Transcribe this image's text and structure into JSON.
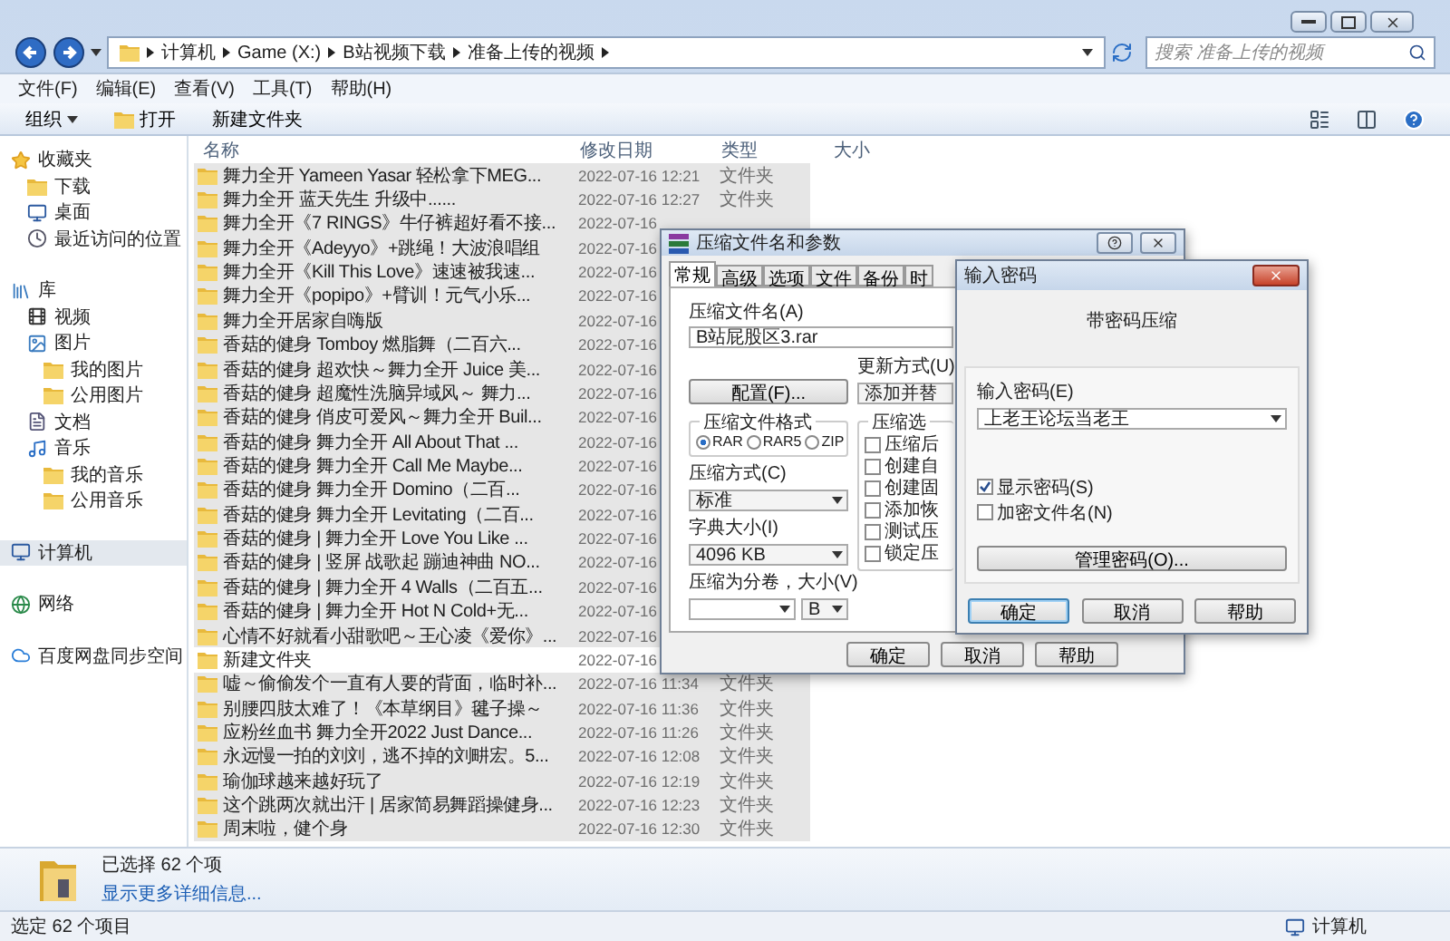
{
  "address_bar": {
    "crumbs": [
      "计算机",
      "Game (X:)",
      "B站视频下载",
      "准备上传的视频"
    ]
  },
  "search": {
    "placeholder": "搜索 准备上传的视频"
  },
  "menu": [
    "文件(F)",
    "编辑(E)",
    "查看(V)",
    "工具(T)",
    "帮助(H)"
  ],
  "toolbar": [
    {
      "kind": "menu",
      "label": "组织"
    },
    {
      "kind": "open",
      "label": "打开"
    },
    {
      "kind": "plain",
      "label": "新建文件夹"
    }
  ],
  "sidebar": [
    {
      "label": "收藏夹",
      "kind": "star",
      "selected": false,
      "children": [
        {
          "label": "下载",
          "kind": "folder",
          "selected": false
        },
        {
          "label": "桌面",
          "kind": "desktop",
          "selected": false
        },
        {
          "label": "最近访问的位置",
          "kind": "recent",
          "selected": false
        }
      ]
    },
    {
      "label": "库",
      "kind": "library",
      "selected": false,
      "children": [
        {
          "label": "视频",
          "kind": "video",
          "selected": false
        },
        {
          "label": "图片",
          "kind": "pictures",
          "selected": false,
          "children": [
            {
              "label": "我的图片",
              "kind": "folder",
              "selected": false
            },
            {
              "label": "公用图片",
              "kind": "folder",
              "selected": false
            }
          ]
        },
        {
          "label": "文档",
          "kind": "document",
          "selected": false
        },
        {
          "label": "音乐",
          "kind": "music",
          "selected": false,
          "children": [
            {
              "label": "我的音乐",
              "kind": "folder",
              "selected": false
            },
            {
              "label": "公用音乐",
              "kind": "folder",
              "selected": false
            }
          ]
        }
      ]
    },
    {
      "label": "计算机",
      "kind": "computer",
      "selected": true
    },
    {
      "label": "网络",
      "kind": "network",
      "selected": false
    },
    {
      "label": "百度网盘同步空间",
      "kind": "cloud",
      "selected": false
    }
  ],
  "table": {
    "columns": [
      "名称",
      "修改日期",
      "类型",
      "大小"
    ],
    "rows": [
      {
        "name": "舞力全开 Yameen Yasar 轻松拿下MEG...",
        "date": "2022-07-16 12:21",
        "type": "文件夹",
        "selected": true
      },
      {
        "name": "舞力全开 蓝天先生  升级中......",
        "date": "2022-07-16 12:27",
        "type": "文件夹",
        "selected": true
      },
      {
        "name": "舞力全开《7 RINGS》牛仔裤超好看不接...",
        "date": "2022-07-16",
        "selected": true
      },
      {
        "name": "舞力全开《Adeyyo》+跳绳！大波浪唱组",
        "date": "2022-07-16",
        "selected": true
      },
      {
        "name": "舞力全开《Kill This Love》速速被我速...",
        "date": "2022-07-16",
        "selected": true
      },
      {
        "name": "舞力全开《popipo》+臂训！元气小乐...",
        "date": "2022-07-16",
        "selected": true
      },
      {
        "name": "舞力全开居家自嗨版",
        "date": "2022-07-16",
        "selected": true
      },
      {
        "name": "香菇的健身  Tomboy 燃脂舞（二百六...",
        "date": "2022-07-16",
        "selected": true
      },
      {
        "name": "香菇的健身  超欢快～舞力全开 Juice 美...",
        "date": "2022-07-16",
        "selected": true
      },
      {
        "name": "香菇的健身  超魔性洗脑异域风～ 舞力...",
        "date": "2022-07-16",
        "selected": true
      },
      {
        "name": "香菇的健身  俏皮可爱风～舞力全开 Buil...",
        "date": "2022-07-16",
        "selected": true
      },
      {
        "name": "香菇的健身  舞力全开 All About That ...",
        "date": "2022-07-16",
        "selected": true
      },
      {
        "name": "香菇的健身  舞力全开 Call Me Maybe...",
        "date": "2022-07-16",
        "selected": true
      },
      {
        "name": "香菇的健身  舞力全开 Domino（二百...",
        "date": "2022-07-16",
        "selected": true
      },
      {
        "name": "香菇的健身  舞力全开 Levitating（二百...",
        "date": "2022-07-16",
        "selected": true
      },
      {
        "name": "香菇的健身 | 舞力全开 Love You Like ...",
        "date": "2022-07-16",
        "selected": true
      },
      {
        "name": "香菇的健身 | 竖屏 战歌起 蹦迪神曲 NO...",
        "date": "2022-07-16",
        "selected": true
      },
      {
        "name": "香菇的健身 | 舞力全开 4 Walls（二百五...",
        "date": "2022-07-16",
        "selected": true
      },
      {
        "name": "香菇的健身 | 舞力全开 Hot N Cold+无...",
        "date": "2022-07-16",
        "selected": true
      },
      {
        "name": "心情不好就看小甜歌吧～王心凌《爱你》...",
        "date": "2022-07-16",
        "selected": true
      },
      {
        "name": "新建文件夹",
        "date": "2022-07-16",
        "selected": false
      },
      {
        "name": "嘘～偷偷发个一直有人要的背面，临时补...",
        "date": "2022-07-16 11:34",
        "type": "文件夹",
        "selected": true
      },
      {
        "name": "别腰四肢太难了！《本草纲目》毽子操～",
        "date": "2022-07-16 11:36",
        "type": "文件夹",
        "selected": true
      },
      {
        "name": "应粉丝血书  舞力全开2022 Just Dance...",
        "date": "2022-07-16 11:26",
        "type": "文件夹",
        "selected": true
      },
      {
        "name": "永远慢一拍的刘刘，逃不掉的刘畊宏。5...",
        "date": "2022-07-16 12:08",
        "type": "文件夹",
        "selected": true
      },
      {
        "name": "瑜伽球越来越好玩了",
        "date": "2022-07-16 12:19",
        "type": "文件夹",
        "selected": true
      },
      {
        "name": "这个跳两次就出汗 | 居家简易舞蹈操健身...",
        "date": "2022-07-16 12:23",
        "type": "文件夹",
        "selected": true
      },
      {
        "name": "周末啦，健个身",
        "date": "2022-07-16 12:30",
        "type": "文件夹",
        "selected": true
      }
    ]
  },
  "details": {
    "summary": "已选择 62 个项",
    "link": "显示更多详细信息..."
  },
  "status_bar": {
    "text": "选定 62 个项目",
    "location": "计算机"
  },
  "compress_dialog": {
    "title": "压缩文件名和参数",
    "tabs": [
      {
        "label": "常规",
        "selected": true
      },
      {
        "label": "高级",
        "selected": false
      },
      {
        "label": "选项",
        "selected": false
      },
      {
        "label": "文件",
        "selected": false
      },
      {
        "label": "备份",
        "selected": false
      },
      {
        "label": "时",
        "selected": false
      }
    ],
    "archive_name_label": "压缩文件名(A)",
    "archive_name": "B站屁股区3.rar",
    "profiles_button": "配置(F)...",
    "update_label": "更新方式(U)",
    "update_value": "添加并替",
    "format_group": "压缩文件格式",
    "formats": [
      {
        "label": "RAR",
        "selected": true
      },
      {
        "label": "RAR5",
        "selected": false
      },
      {
        "label": "ZIP",
        "selected": false
      }
    ],
    "options_group": "压缩选",
    "options": [
      {
        "label": "压缩后",
        "checked": false
      },
      {
        "label": "创建自",
        "checked": false
      },
      {
        "label": "创建固",
        "checked": false
      },
      {
        "label": "添加恢",
        "checked": false
      },
      {
        "label": "测试压",
        "checked": false
      },
      {
        "label": "锁定压",
        "checked": false
      }
    ],
    "method_label": "压缩方式(C)",
    "method": "标准",
    "dict_label": "字典大小(I)",
    "dict": "4096 KB",
    "volume_label": "压缩为分卷，大小(V)",
    "volume_unit": "B",
    "buttons": [
      "确定",
      "取消",
      "帮助"
    ]
  },
  "password_dialog": {
    "title": "输入密码",
    "heading": "带密码压缩",
    "password_label": "输入密码(E)",
    "password": "上老王论坛当老王",
    "show_password": {
      "label": "显示密码(S)",
      "checked": true
    },
    "encrypt_names": {
      "label": "加密文件名(N)",
      "checked": false
    },
    "manage_button": "管理密码(O)...",
    "buttons": [
      {
        "label": "确定",
        "default": true
      },
      {
        "label": "取消",
        "default": false
      },
      {
        "label": "帮助",
        "default": false
      }
    ]
  }
}
